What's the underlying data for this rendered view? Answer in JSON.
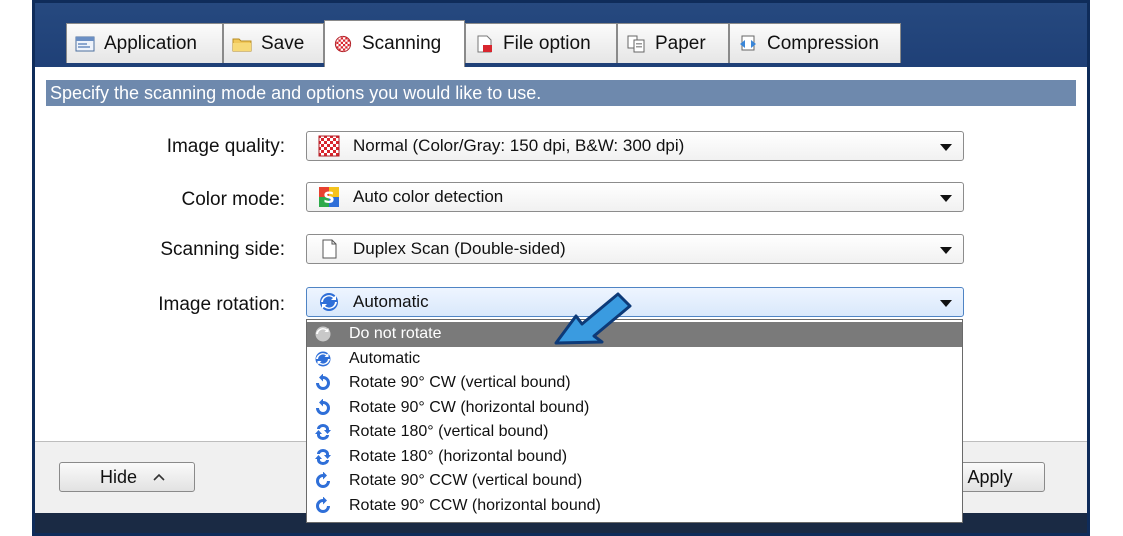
{
  "tabs": [
    {
      "label": "Application",
      "icon": "application-icon"
    },
    {
      "label": "Save",
      "icon": "folder-icon"
    },
    {
      "label": "Scanning",
      "icon": "scanning-icon",
      "active": true
    },
    {
      "label": "File option",
      "icon": "file-option-icon"
    },
    {
      "label": "Paper",
      "icon": "paper-icon"
    },
    {
      "label": "Compression",
      "icon": "compression-icon"
    }
  ],
  "info_text": "Specify the scanning mode and options you would like to use.",
  "fields": {
    "image_quality": {
      "label": "Image quality:",
      "value": "Normal (Color/Gray: 150 dpi, B&W: 300 dpi)",
      "icon": "checker-quality-icon"
    },
    "color_mode": {
      "label": "Color mode:",
      "value": "Auto color detection",
      "icon": "auto-color-icon"
    },
    "scanning_side": {
      "label": "Scanning side:",
      "value": "Duplex Scan (Double-sided)",
      "icon": "duplex-page-icon"
    },
    "image_rotation": {
      "label": "Image rotation:",
      "value": "Automatic",
      "icon": "auto-rotate-icon"
    }
  },
  "rotation_options": [
    {
      "label": "Do not rotate",
      "icon": "no-rotate-icon",
      "highlighted": true
    },
    {
      "label": "Automatic",
      "icon": "auto-rotate-icon"
    },
    {
      "label": "Rotate 90° CW (vertical bound)",
      "icon": "rotate-cw-icon"
    },
    {
      "label": "Rotate 90° CW (horizontal bound)",
      "icon": "rotate-cw-icon"
    },
    {
      "label": "Rotate 180° (vertical bound)",
      "icon": "rotate-180-icon"
    },
    {
      "label": "Rotate 180° (horizontal bound)",
      "icon": "rotate-180-icon"
    },
    {
      "label": "Rotate 90° CCW (vertical bound)",
      "icon": "rotate-ccw-icon"
    },
    {
      "label": "Rotate 90° CCW (horizontal bound)",
      "icon": "rotate-ccw-icon"
    }
  ],
  "footer": {
    "hide_label": "Hide",
    "apply_label": "Apply"
  },
  "colors": {
    "frame": "#1b3a6e",
    "info_bar": "#6e89ad",
    "highlight": "#7a7a7a",
    "pointer_arrow": "#3a9be0"
  }
}
